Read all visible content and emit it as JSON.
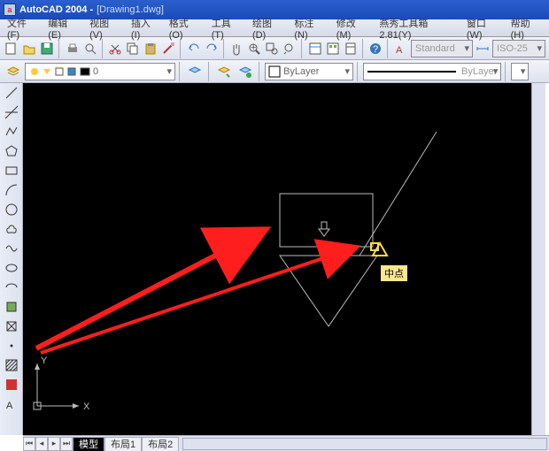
{
  "title": {
    "app": "AutoCAD 2004 -",
    "file": "[Drawing1.dwg]"
  },
  "menu": {
    "file": "文件(F)",
    "edit": "编辑(E)",
    "view": "视图(V)",
    "insert": "插入(I)",
    "format": "格式(O)",
    "tools": "工具(T)",
    "draw": "绘图(D)",
    "dimension": "标注(N)",
    "modify": "修改(M)",
    "yanxiu": "燕秀工具箱2.81(Y)",
    "window": "窗口(W)",
    "help": "帮助(H)"
  },
  "dropdowns": {
    "style": "Standard",
    "dim": "ISO-25",
    "layer": "ByLayer",
    "linetype": "ByLayer"
  },
  "tabs": {
    "model": "模型",
    "layout1": "布局1",
    "layout2": "布局2"
  },
  "ucs": {
    "x": "X",
    "y": "Y"
  },
  "tooltip": "中点"
}
